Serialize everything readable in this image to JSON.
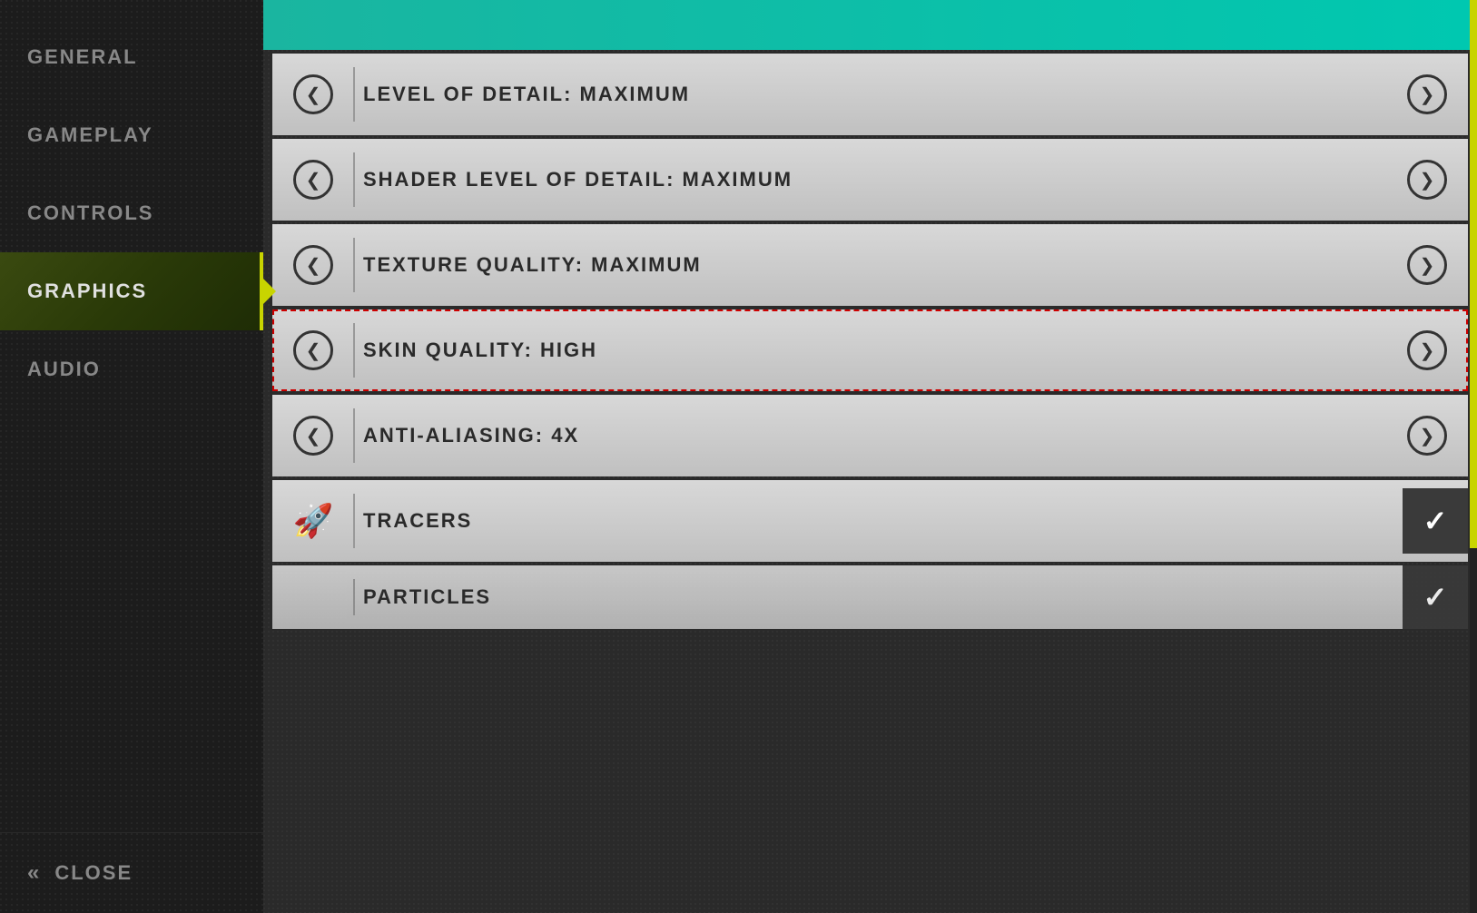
{
  "sidebar": {
    "items": [
      {
        "id": "general",
        "label": "GENERAL",
        "active": false
      },
      {
        "id": "gameplay",
        "label": "GAMEPLAY",
        "active": false
      },
      {
        "id": "controls",
        "label": "CONTROLS",
        "active": false
      },
      {
        "id": "graphics",
        "label": "GRAPHICS",
        "active": true
      },
      {
        "id": "audio",
        "label": "AUDIO",
        "active": false
      }
    ],
    "close_label": "CLOSE"
  },
  "settings": {
    "rows": [
      {
        "id": "level-of-detail",
        "type": "slider",
        "label": "LEVEL OF DETAIL: MAXIMUM",
        "highlighted": false
      },
      {
        "id": "shader-lod",
        "type": "slider",
        "label": "SHADER LEVEL OF DETAIL: MAXIMUM",
        "highlighted": false
      },
      {
        "id": "texture-quality",
        "type": "slider",
        "label": "TEXTURE QUALITY: MAXIMUM",
        "highlighted": false
      },
      {
        "id": "skin-quality",
        "type": "slider",
        "label": "SKIN QUALITY: HIGH",
        "highlighted": true
      },
      {
        "id": "anti-aliasing",
        "type": "slider",
        "label": "ANTI-ALIASING: 4X",
        "highlighted": false
      },
      {
        "id": "tracers",
        "type": "toggle",
        "label": "TRACERS",
        "checked": true
      },
      {
        "id": "particles",
        "type": "toggle",
        "label": "PARTICLES",
        "checked": true,
        "partial": true
      }
    ]
  },
  "icons": {
    "left_arrow": "❮",
    "right_arrow": "❯",
    "double_left_arrow": "«",
    "checkmark": "✓",
    "rocket": "🚀"
  }
}
